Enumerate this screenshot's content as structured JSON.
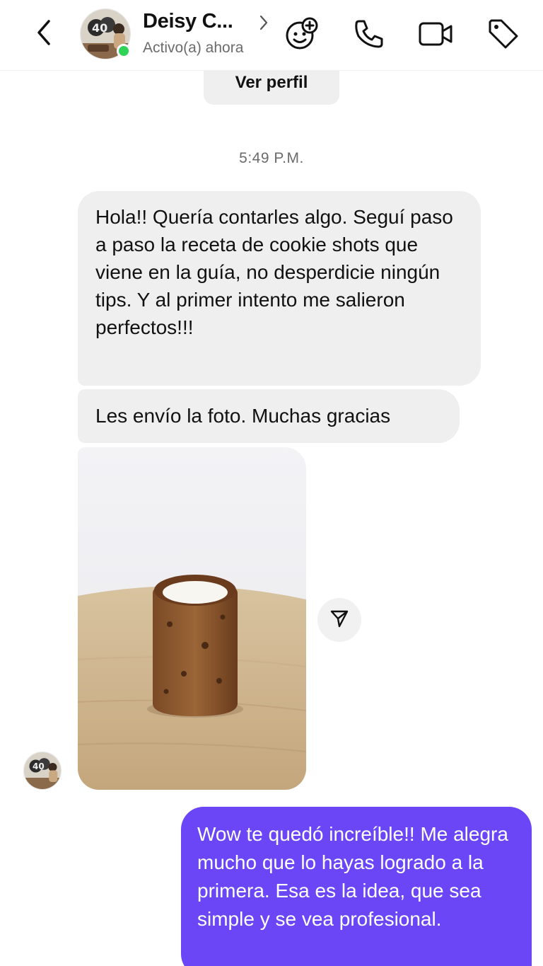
{
  "header": {
    "contact_name": "Deisy C...",
    "status": "Activo(a) ahora",
    "icons": [
      "back-arrow-icon",
      "chevron-right-icon",
      "add-effect-icon",
      "phone-icon",
      "video-camera-icon",
      "tag-icon"
    ]
  },
  "profile": {
    "view_profile_label": "Ver perfil"
  },
  "conversation": {
    "timestamp": "5:49 P.M.",
    "messages": [
      {
        "direction": "incoming",
        "text": "Hola!! Quería contarles algo. Seguí paso a paso la receta de cookie shots que viene en la guía, no desperdicie ningún tips. Y al primer intento me salieron perfectos!!!"
      },
      {
        "direction": "incoming",
        "text": "Les envío la foto. Muchas gracias"
      },
      {
        "direction": "incoming",
        "type": "photo"
      },
      {
        "direction": "outgoing",
        "text": "Wow te quedó increíble!! Me alegra mucho que lo hayas logrado a la primera. Esa es la idea, que sea simple y se vea profesional."
      }
    ]
  },
  "colors": {
    "outgoing_bubble": "#6a46f6",
    "incoming_bubble": "#efefef",
    "online_indicator": "#2fd357"
  }
}
